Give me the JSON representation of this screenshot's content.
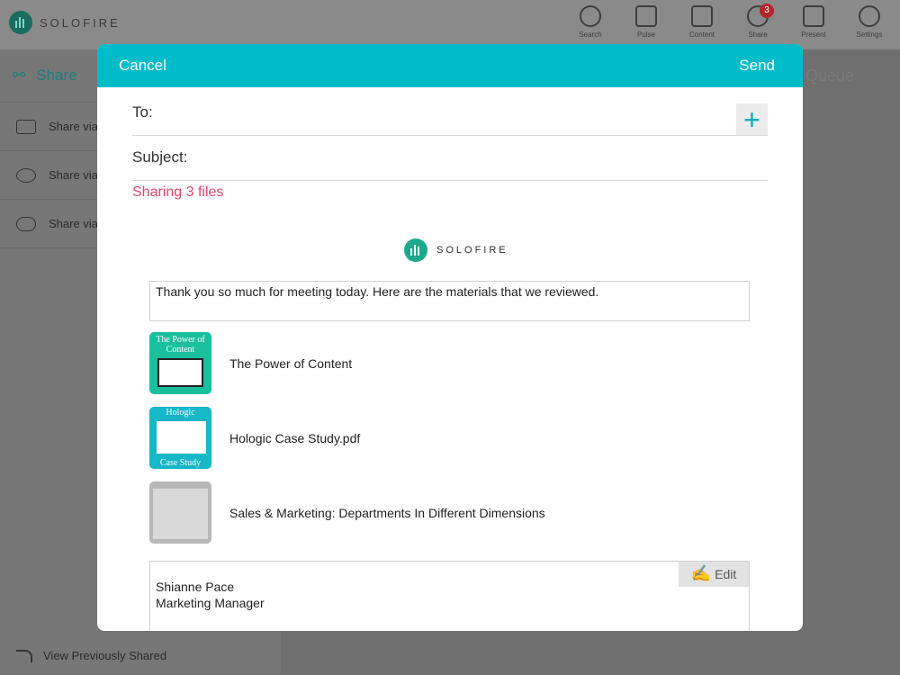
{
  "app": {
    "logo_text": "SOLOFIRE"
  },
  "topnav": {
    "items": [
      {
        "label": "Search",
        "icon": "search-icon"
      },
      {
        "label": "Pulse",
        "icon": "pulse-icon"
      },
      {
        "label": "Content",
        "icon": "content-icon"
      },
      {
        "label": "Share",
        "icon": "share-icon",
        "badge": "3"
      },
      {
        "label": "Present",
        "icon": "present-icon"
      },
      {
        "label": "Settings",
        "icon": "gear-icon"
      }
    ]
  },
  "sidebar": {
    "title": "Share",
    "items": [
      {
        "label": "Share via",
        "icon": "mail-icon"
      },
      {
        "label": "Share via",
        "icon": "message-icon"
      },
      {
        "label": "Share via L",
        "icon": "link-icon"
      }
    ],
    "footer": "View Previously Shared"
  },
  "background": {
    "queue_label": "e Queue"
  },
  "modal": {
    "cancel": "Cancel",
    "send": "Send",
    "to_label": "To:",
    "add_icon": "+",
    "subject_label": "Subject:",
    "sharing_text": "Sharing 3 files",
    "logo_text": "SOLOFIRE",
    "message": "Thank you so much for meeting today.  Here are the materials that we reviewed.",
    "files": [
      {
        "name": "The Power of Content",
        "thumb_title": "The Power of Content",
        "thumb_footer": ""
      },
      {
        "name": "Hologic Case Study.pdf",
        "thumb_title": "Hologic",
        "thumb_footer": "Case Study"
      },
      {
        "name": "Sales & Marketing: Departments In Different Dimensions",
        "thumb_title": "",
        "thumb_footer": ""
      }
    ],
    "signature": {
      "name": "Shianne Pace",
      "title": "Marketing Manager",
      "edit_label": "Edit"
    }
  },
  "colors": {
    "accent": "#00bcc9",
    "sharing": "#e0456e"
  }
}
